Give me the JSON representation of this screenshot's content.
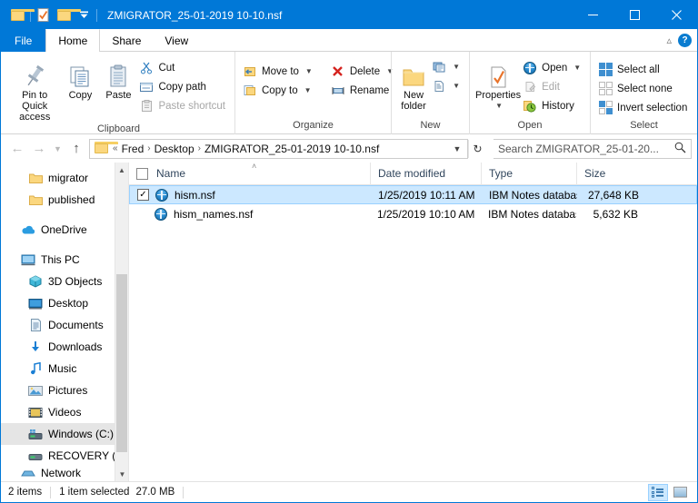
{
  "window": {
    "title": "ZMIGRATOR_25-01-2019 10-10.nsf",
    "minimize_label": "Minimize",
    "maximize_label": "Maximize",
    "close_label": "Close",
    "accent_color": "#0078d7"
  },
  "quick_access": {
    "items": [
      {
        "icon": "folder-icon",
        "label": "Explorer"
      },
      {
        "icon": "properties-icon",
        "label": "Properties"
      },
      {
        "icon": "new-folder-icon",
        "label": "New folder"
      },
      {
        "icon": "chevron-down-icon",
        "label": "Customize Quick Access Toolbar"
      }
    ]
  },
  "tabs": [
    {
      "id": "file",
      "label": "File",
      "active": false
    },
    {
      "id": "home",
      "label": "Home",
      "active": true
    },
    {
      "id": "share",
      "label": "Share",
      "active": false
    },
    {
      "id": "view",
      "label": "View",
      "active": false
    }
  ],
  "ribbon_right": {
    "collapse_icon": "chevron-up-icon",
    "help_label": "?"
  },
  "ribbon": {
    "groups": [
      {
        "name": "Clipboard",
        "label": "Clipboard",
        "big_buttons": [
          {
            "label": "Pin to Quick\naccess",
            "line1": "Pin to Quick",
            "line2": "access",
            "icon": "pin-icon"
          },
          {
            "label": "Copy",
            "line1": "Copy",
            "line2": "",
            "icon": "copy-icon"
          },
          {
            "label": "Paste",
            "line1": "Paste",
            "line2": "",
            "icon": "paste-icon"
          }
        ],
        "small_buttons": [
          {
            "label": "Cut",
            "icon": "scissors-icon",
            "disabled": false,
            "caret": false
          },
          {
            "label": "Copy path",
            "icon": "copy-path-icon",
            "disabled": false,
            "caret": false
          },
          {
            "label": "Paste shortcut",
            "icon": "paste-shortcut-icon",
            "disabled": true,
            "caret": false
          }
        ]
      },
      {
        "name": "Organize",
        "label": "Organize",
        "small_buttons": [
          {
            "label": "Move to",
            "icon": "move-to-icon",
            "disabled": false,
            "caret": true
          },
          {
            "label": "Copy to",
            "icon": "copy-to-icon",
            "disabled": false,
            "caret": true
          },
          {
            "label": "Delete",
            "icon": "delete-icon",
            "disabled": false,
            "caret": true
          },
          {
            "label": "Rename",
            "icon": "rename-icon",
            "disabled": false,
            "caret": false
          }
        ]
      },
      {
        "name": "New",
        "label": "New",
        "big_buttons": [
          {
            "line1": "New",
            "line2": "folder",
            "icon": "new-folder-icon"
          }
        ],
        "small_buttons": [
          {
            "label": "",
            "icon": "new-item-icon",
            "disabled": false,
            "caret": true
          },
          {
            "label": "",
            "icon": "easy-access-icon",
            "disabled": false,
            "caret": true
          }
        ]
      },
      {
        "name": "Open",
        "label": "Open",
        "big_buttons": [
          {
            "line1": "Properties",
            "line2": "",
            "icon": "properties-icon",
            "caret": true
          }
        ],
        "small_buttons": [
          {
            "label": "Open",
            "icon": "notes-icon",
            "disabled": false,
            "caret": true
          },
          {
            "label": "Edit",
            "icon": "edit-icon",
            "disabled": true,
            "caret": false
          },
          {
            "label": "History",
            "icon": "history-icon",
            "disabled": false,
            "caret": false
          }
        ]
      },
      {
        "name": "Select",
        "label": "Select",
        "small_buttons": [
          {
            "label": "Select all",
            "icon": "select-all-icon",
            "disabled": false,
            "caret": false
          },
          {
            "label": "Select none",
            "icon": "select-none-icon",
            "disabled": false,
            "caret": false
          },
          {
            "label": "Invert selection",
            "icon": "invert-selection-icon",
            "disabled": false,
            "caret": false
          }
        ]
      }
    ]
  },
  "address_bar": {
    "back_icon": "arrow-left-icon",
    "forward_icon": "arrow-right-icon",
    "recent_icon": "chevron-down-icon",
    "up_icon": "arrow-up-icon",
    "overflow": "«",
    "breadcrumbs": [
      {
        "label": "Fred"
      },
      {
        "label": "Desktop"
      },
      {
        "label": "ZMIGRATOR_25-01-2019 10-10.nsf"
      }
    ],
    "separator": "›",
    "dropdown_icon": "chevron-down-icon",
    "refresh_icon": "refresh-icon"
  },
  "search": {
    "placeholder": "Search ZMIGRATOR_25-01-20...",
    "value": "",
    "icon": "search-icon"
  },
  "sidebar": {
    "items": [
      {
        "label": "migrator",
        "icon": "folder-icon",
        "indent": true,
        "hover": false
      },
      {
        "label": "published",
        "icon": "folder-icon",
        "indent": true,
        "hover": false
      },
      {
        "gap": true
      },
      {
        "label": "OneDrive",
        "icon": "onedrive-icon",
        "indent": false,
        "hover": false
      },
      {
        "gap": true
      },
      {
        "label": "This PC",
        "icon": "this-pc-icon",
        "indent": false,
        "hover": false
      },
      {
        "label": "3D Objects",
        "icon": "3d-objects-icon",
        "indent": true,
        "hover": false
      },
      {
        "label": "Desktop",
        "icon": "desktop-icon",
        "indent": true,
        "hover": false
      },
      {
        "label": "Documents",
        "icon": "documents-icon",
        "indent": true,
        "hover": false
      },
      {
        "label": "Downloads",
        "icon": "downloads-icon",
        "indent": true,
        "hover": false
      },
      {
        "label": "Music",
        "icon": "music-icon",
        "indent": true,
        "hover": false
      },
      {
        "label": "Pictures",
        "icon": "pictures-icon",
        "indent": true,
        "hover": false
      },
      {
        "label": "Videos",
        "icon": "videos-icon",
        "indent": true,
        "hover": false
      },
      {
        "label": "Windows (C:)",
        "icon": "drive-icon",
        "indent": true,
        "hover": true
      },
      {
        "label": "RECOVERY (D:)",
        "icon": "drive-icon",
        "indent": true,
        "hover": false
      },
      {
        "label": "Network",
        "icon": "network-icon",
        "indent": false,
        "hover": false
      }
    ]
  },
  "file_list": {
    "columns": [
      {
        "key": "name",
        "label": "Name",
        "sorted": true
      },
      {
        "key": "date",
        "label": "Date modified",
        "sorted": false
      },
      {
        "key": "type",
        "label": "Type",
        "sorted": false
      },
      {
        "key": "size",
        "label": "Size",
        "sorted": false
      }
    ],
    "sort_indicator": "˄",
    "rows": [
      {
        "name": "hism.nsf",
        "date": "1/25/2019 10:11 AM",
        "type": "IBM Notes database",
        "size": "27,648 KB",
        "icon": "notes-icon",
        "selected": true,
        "checked": true
      },
      {
        "name": "hism_names.nsf",
        "date": "1/25/2019 10:10 AM",
        "type": "IBM Notes database",
        "size": "5,632 KB",
        "icon": "notes-icon",
        "selected": false,
        "checked": false
      }
    ]
  },
  "status_bar": {
    "item_count": "2 items",
    "selection": "1 item selected",
    "selection_size": "27.0 MB",
    "views": [
      {
        "id": "details",
        "label": "Details view",
        "icon": "details-view-icon",
        "active": true
      },
      {
        "id": "thumbnails",
        "label": "Large icons view",
        "icon": "thumbnail-view-icon",
        "active": false
      }
    ]
  }
}
